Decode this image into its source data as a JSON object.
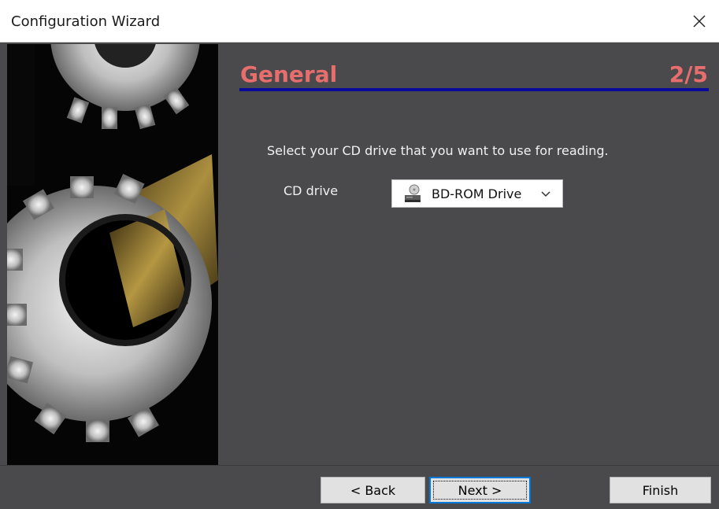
{
  "window": {
    "title": "Configuration Wizard",
    "close_glyph": "✕"
  },
  "header": {
    "title": "General",
    "step": "2/5",
    "accent_color": "#e86e6e",
    "underline_color": "#0a0a9a"
  },
  "body": {
    "instruction": "Select your CD drive that you want to use for reading.",
    "drive_label": "CD drive",
    "drive_value": "BD-ROM Drive"
  },
  "footer": {
    "back_label": "< Back",
    "next_label": "Next >",
    "finish_label": "Finish"
  },
  "icons": {
    "side_image": "gears-image",
    "drive": "optical-drive-icon",
    "dropdown": "chevron-down-icon",
    "close": "close-icon"
  }
}
